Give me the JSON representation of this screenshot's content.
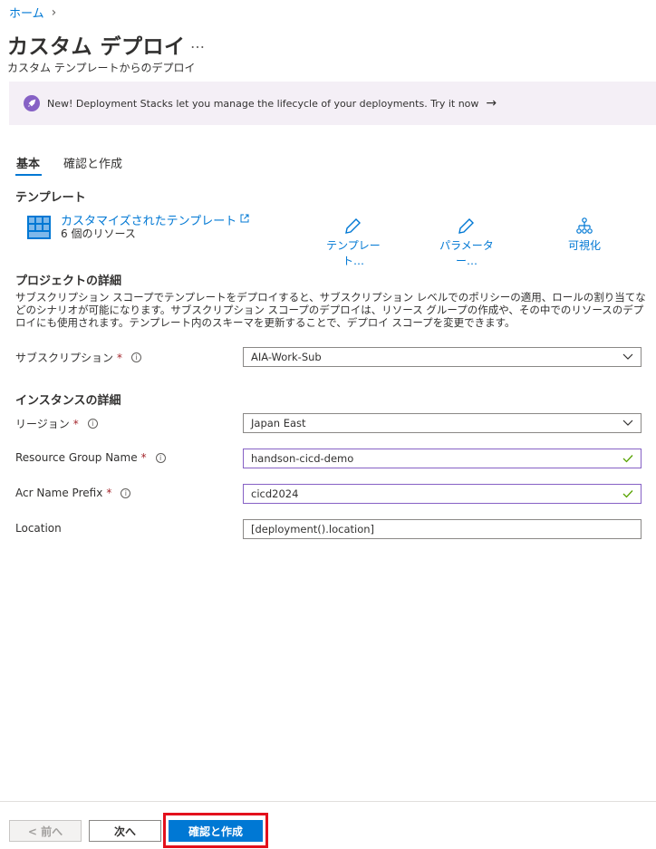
{
  "breadcrumb": {
    "home": "ホーム",
    "separator": "›"
  },
  "page": {
    "title": "カスタム デプロイ",
    "more": "…",
    "subtitle": "カスタム テンプレートからのデプロイ"
  },
  "banner": {
    "text": "New! Deployment Stacks let you manage the lifecycle of your deployments. Try it now",
    "arrow": "→"
  },
  "tabs": [
    {
      "label": "基本",
      "active": true
    },
    {
      "label": "確認と作成",
      "active": false
    }
  ],
  "template": {
    "heading": "テンプレート",
    "link": "カスタマイズされたテンプレート",
    "resources": "6 個のリソース",
    "actions": {
      "edit_template": "テンプレート…",
      "edit_params": "パラメーター…",
      "visualize": "可視化"
    }
  },
  "project": {
    "heading": "プロジェクトの詳細",
    "description": "サブスクリプション スコープでテンプレートをデプロイすると、サブスクリプション レベルでのポリシーの適用、ロールの割り当てなどのシナリオが可能になります。サブスクリプション スコープのデプロイは、リソース グループの作成や、その中でのリソースのデプロイにも使用されます。テンプレート内のスキーマを更新することで、デプロイ スコープを変更できます。",
    "subscription_label": "サブスクリプション",
    "subscription_value": "AIA-Work-Sub"
  },
  "instance": {
    "heading": "インスタンスの詳細",
    "region_label": "リージョン",
    "region_value": "Japan East",
    "rg_label": "Resource Group Name",
    "rg_value": "handson-cicd-demo",
    "acr_label": "Acr Name Prefix",
    "acr_value": "cicd2024",
    "location_label": "Location",
    "location_value": "[deployment().location]"
  },
  "required_mark": "*",
  "footer": {
    "prev": "< 前へ",
    "next": "次へ",
    "review_create": "確認と作成"
  },
  "colors": {
    "accent": "#0078d4",
    "valid": "#8661c5",
    "check": "#57a300",
    "highlight": "#e3101c"
  }
}
